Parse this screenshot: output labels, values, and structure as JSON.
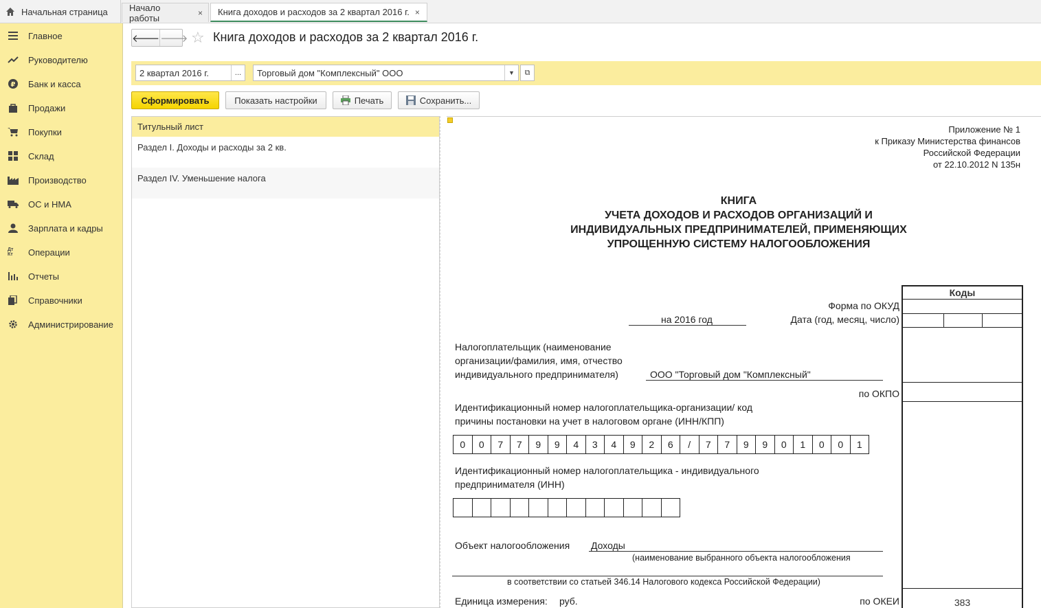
{
  "tabs": {
    "home": "Начальная страница",
    "items": [
      {
        "label": "Начало работы",
        "close": "×"
      },
      {
        "label": "Книга доходов и расходов за 2 квартал 2016 г.",
        "close": "×"
      }
    ]
  },
  "sidebar": {
    "items": [
      {
        "label": "Главное",
        "icon": "menu-icon"
      },
      {
        "label": "Руководителю",
        "icon": "trend-icon"
      },
      {
        "label": "Банк и касса",
        "icon": "ruble-icon"
      },
      {
        "label": "Продажи",
        "icon": "bag-icon"
      },
      {
        "label": "Покупки",
        "icon": "cart-icon"
      },
      {
        "label": "Склад",
        "icon": "warehouse-icon"
      },
      {
        "label": "Производство",
        "icon": "factory-icon"
      },
      {
        "label": "ОС и НМА",
        "icon": "truck-icon"
      },
      {
        "label": "Зарплата и кадры",
        "icon": "person-icon"
      },
      {
        "label": "Операции",
        "icon": "dt-kt-icon",
        "glyph": "Дт Кт"
      },
      {
        "label": "Отчеты",
        "icon": "bar-chart-icon"
      },
      {
        "label": "Справочники",
        "icon": "books-icon"
      },
      {
        "label": "Администрирование",
        "icon": "gear-icon"
      }
    ]
  },
  "header": {
    "title": "Книга доходов и расходов за 2 квартал 2016 г.",
    "back": "🡐",
    "forward": "🡒",
    "star": "☆"
  },
  "filters": {
    "period": "2 квартал 2016 г.",
    "period_btn": "...",
    "organization": "Торговый дом \"Комплексный\" ООО"
  },
  "toolbar": {
    "generate": "Сформировать",
    "show_settings": "Показать настройки",
    "print": "Печать",
    "save": "Сохранить..."
  },
  "sections": [
    "Титульный лист",
    "Раздел I. Доходы и расходы за 2 кв.",
    "Раздел IV. Уменьшение налога"
  ],
  "document": {
    "appendix": [
      "Приложение № 1",
      "к Приказу Министерства финансов",
      "Российской Федерации",
      "от 22.10.2012 N 135н"
    ],
    "title": [
      "КНИГА",
      "УЧЕТА ДОХОДОВ И РАСХОДОВ ОРГАНИЗАЦИЙ И",
      "ИНДИВИДУАЛЬНЫХ ПРЕДПРИНИМАТЕЛЕЙ, ПРИМЕНЯЮЩИХ",
      "УПРОЩЕННУЮ СИСТЕМУ НАЛОГООБЛОЖЕНИЯ"
    ],
    "codes_header": "Коды",
    "okud_label": "Форма по ОКУД",
    "year_text": "на 2016 год",
    "date_label": "Дата (год, месяц, число)",
    "taxpayer_label": [
      "Налогоплательщик (наименование",
      "организации/фамилия, имя, отчество",
      "индивидуального предпринимателя)"
    ],
    "taxpayer_value": "ООО \"Торговый дом \"Комплексный\"",
    "okpo_label": "по ОКПО",
    "inn_kpp_label": [
      "Идентификационный номер налогоплательщика-организации/ код",
      "причины постановки на учет в налоговом органе (ИНН/КПП)"
    ],
    "inn_kpp_digits": [
      "0",
      "0",
      "7",
      "7",
      "9",
      "9",
      "4",
      "3",
      "4",
      "9",
      "2",
      "6",
      "/",
      "7",
      "7",
      "9",
      "9",
      "0",
      "1",
      "0",
      "0",
      "1"
    ],
    "inn_ip_label": [
      "Идентификационный номер налогоплательщика - индивидуального",
      "предпринимателя (ИНН)"
    ],
    "object_label": "Объект налогообложения",
    "object_value": "Доходы",
    "object_hint": "(наименование выбранного объекта налогообложения",
    "article_text": "в соответствии со статьей 346.14 Налогового кодекса Российской Федерации)",
    "unit_label": "Единица измерения:",
    "unit_value": "руб.",
    "okei_label": "по ОКЕИ",
    "okei_value": "383"
  }
}
